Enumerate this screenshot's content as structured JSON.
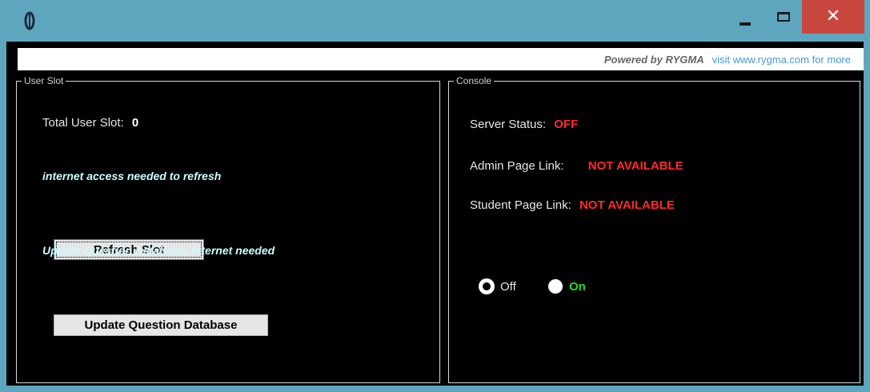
{
  "window": {
    "icon": "app-logo-icon",
    "controls": {
      "minimize": "minimize-icon",
      "maximize": "maximize-icon",
      "close": "close-icon",
      "close_glyph": "✕"
    }
  },
  "banner": {
    "powered_by": "Powered by RYGMA",
    "link_text": "visit www.rygma.com for more"
  },
  "user_slot": {
    "legend": "User Slot",
    "total_label": "Total User Slot:",
    "total_value": "0",
    "refresh_hint": "internet access needed to refresh",
    "refresh_button": "Refresh Slot",
    "update_hint": "Update Question Database. Internet needed",
    "update_button": "Update Question Database"
  },
  "console": {
    "legend": "Console",
    "server_status_label": "Server Status:",
    "server_status_value": "OFF",
    "admin_link_label": "Admin Page Link:",
    "admin_link_value": "NOT AVAILABLE",
    "student_link_label": "Student Page Link:",
    "student_link_value": "NOT AVAILABLE",
    "radio_off": "Off",
    "radio_on": "On",
    "selected": "Off"
  },
  "colors": {
    "titlebar": "#5ea6bd",
    "close_button": "#c7463e",
    "status_red": "#ff2a2a",
    "on_green": "#22dd22",
    "link_blue": "#4a97d2"
  }
}
